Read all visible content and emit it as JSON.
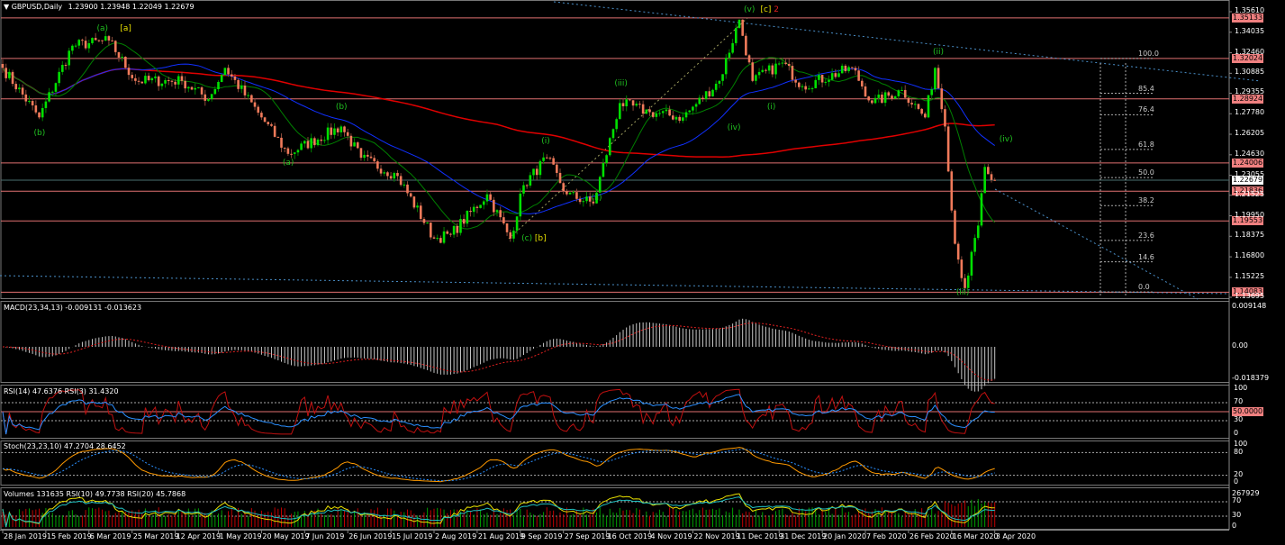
{
  "header": {
    "symbol_label": "▼ GBPUSD,Daily",
    "ohlc": "1.23900 1.23948 1.22049 1.22679"
  },
  "indicators": {
    "macd": "MACD(23,34,13) -0.009131 -0.013623",
    "rsi": "RSI(14) 47.6376  RSI(3) 31.4320",
    "stoch": "Stoch(23,23,10) 47.2704 28.6452",
    "volumes": "Volumes 131635  RSI(10) 49.7738  RSI(20) 45.7868"
  },
  "colors": {
    "bull": "#00e000",
    "bear": "#f07a5a",
    "level": "#e07070",
    "ma_long": "#e00000",
    "ma_mid": "#1030ff",
    "ma_fast": "#008000",
    "trend": "#4a8fc8"
  },
  "chart_data": {
    "type": "candlestick",
    "title": "GBPUSD,Daily",
    "ylim": [
      1.13695,
      1.3561
    ],
    "y_ticks": [
      "1.35610",
      "1.34035",
      "1.32460",
      "1.30885",
      "1.29355",
      "1.27780",
      "1.26205",
      "1.24630",
      "1.23055",
      "1.21525",
      "1.19950",
      "1.18375",
      "1.16800",
      "1.15225",
      "1.13695"
    ],
    "y_tick_values": [
      1.3561,
      1.34035,
      1.3246,
      1.30885,
      1.29355,
      1.2778,
      1.26205,
      1.2463,
      1.23055,
      1.21525,
      1.1995,
      1.18375,
      1.168,
      1.15225,
      1.13695
    ],
    "x_ticks": [
      "28 Jan 2019",
      "15 Feb 2019",
      "6 Mar 2019",
      "25 Mar 2019",
      "12 Apr 2019",
      "1 May 2019",
      "20 May 2019",
      "7 Jun 2019",
      "26 Jun 2019",
      "15 Jul 2019",
      "2 Aug 2019",
      "21 Aug 2019",
      "9 Sep 2019",
      "27 Sep 2019",
      "16 Oct 2019",
      "4 Nov 2019",
      "22 Nov 2019",
      "11 Dec 2019",
      "31 Dec 2019",
      "20 Jan 2020",
      "7 Feb 2020",
      "26 Feb 2020",
      "16 Mar 2020",
      "3 Apr 2020"
    ],
    "bars_per_tick": 13,
    "close_path": [
      [
        0,
        1.313
      ],
      [
        11,
        1.275
      ],
      [
        21,
        1.33
      ],
      [
        32,
        1.334
      ],
      [
        40,
        1.303
      ],
      [
        54,
        1.303
      ],
      [
        62,
        1.289
      ],
      [
        67,
        1.313
      ],
      [
        78,
        1.275
      ],
      [
        86,
        1.247
      ],
      [
        102,
        1.268
      ],
      [
        108,
        1.244
      ],
      [
        119,
        1.23
      ],
      [
        130,
        1.182
      ],
      [
        135,
        1.185
      ],
      [
        146,
        1.216
      ],
      [
        153,
        1.182
      ],
      [
        157,
        1.223
      ],
      [
        164,
        1.244
      ],
      [
        170,
        1.216
      ],
      [
        178,
        1.209
      ],
      [
        186,
        1.286
      ],
      [
        195,
        1.279
      ],
      [
        205,
        1.275
      ],
      [
        216,
        1.303
      ],
      [
        222,
        1.35
      ],
      [
        226,
        1.303
      ],
      [
        235,
        1.317
      ],
      [
        241,
        1.299
      ],
      [
        256,
        1.313
      ],
      [
        262,
        1.286
      ],
      [
        271,
        1.296
      ],
      [
        278,
        1.275
      ],
      [
        281,
        1.313
      ],
      [
        284,
        1.268
      ],
      [
        287,
        1.178
      ],
      [
        290,
        1.144
      ],
      [
        294,
        1.192
      ],
      [
        296,
        1.237
      ],
      [
        298,
        1.227
      ],
      [
        299,
        1.2268
      ]
    ],
    "horizontal_levels": [
      {
        "label": "1.35133",
        "value": 1.35133
      },
      {
        "label": "1.32024",
        "value": 1.32024
      },
      {
        "label": "1.28924",
        "value": 1.28924
      },
      {
        "label": "1.24006",
        "value": 1.24006
      },
      {
        "label": "1.21836",
        "value": 1.21836
      },
      {
        "label": "1.19553",
        "value": 1.19553
      },
      {
        "label": "1.14083",
        "value": 1.14083
      }
    ],
    "current_price": {
      "label": "1.22679",
      "value": 1.22679
    },
    "fib_levels": [
      {
        "label": "100.0",
        "value": 1.32024
      },
      {
        "label": "85.4",
        "value": 1.2935
      },
      {
        "label": "76.4",
        "value": 1.277
      },
      {
        "label": "61.8",
        "value": 1.2504
      },
      {
        "label": "50.0",
        "value": 1.2288
      },
      {
        "label": "38.2",
        "value": 1.2073
      },
      {
        "label": "23.6",
        "value": 1.1806
      },
      {
        "label": "14.6",
        "value": 1.1642
      },
      {
        "label": "0.0",
        "value": 1.141
      }
    ],
    "wave_labels": [
      {
        "text": "(b)",
        "bar": 11,
        "price": 1.262,
        "color": "#20c020"
      },
      {
        "text": "(a)",
        "bar": 30,
        "price": 1.342,
        "color": "#20c020"
      },
      {
        "text": "[a]",
        "bar": 37,
        "price": 1.342,
        "color": "#e8e000"
      },
      {
        "text": "(a)",
        "bar": 86,
        "price": 1.239,
        "color": "#20c020"
      },
      {
        "text": "(b)",
        "bar": 102,
        "price": 1.282,
        "color": "#20c020"
      },
      {
        "text": "(c)",
        "bar": 158,
        "price": 1.181,
        "color": "#20c020"
      },
      {
        "text": "[b]",
        "bar": 162,
        "price": 1.181,
        "color": "#e8e000"
      },
      {
        "text": "(i)",
        "bar": 164,
        "price": 1.256,
        "color": "#20c020"
      },
      {
        "text": "(ii)",
        "bar": 179,
        "price": 1.212,
        "color": "#20c020"
      },
      {
        "text": "(iii)",
        "bar": 186,
        "price": 1.3,
        "color": "#20c020"
      },
      {
        "text": "(iv)",
        "bar": 220,
        "price": 1.266,
        "color": "#20c020"
      },
      {
        "text": "(v)",
        "bar": 225,
        "price": 1.357,
        "color": "#20c020"
      },
      {
        "text": "[c]",
        "bar": 230,
        "price": 1.357,
        "color": "#e8e000"
      },
      {
        "text": "2",
        "bar": 234,
        "price": 1.357,
        "color": "#e02020"
      },
      {
        "text": "(i)",
        "bar": 232,
        "price": 1.282,
        "color": "#20c020"
      },
      {
        "text": "(ii)",
        "bar": 282,
        "price": 1.324,
        "color": "#20c020"
      },
      {
        "text": "(iii)",
        "bar": 289,
        "price": 1.14,
        "color": "#20c020"
      },
      {
        "text": "(iv)",
        "bar": 302,
        "price": 1.257,
        "color": "#20c020"
      }
    ],
    "macd_axis": [
      "0.009148",
      "0.00",
      "-0.018379"
    ],
    "rsi_axis": [
      "100",
      "70",
      "50.0000",
      "30",
      "0"
    ],
    "stoch_axis": [
      "100",
      "80",
      "20",
      "0"
    ],
    "volume_axis": [
      "267929",
      "70",
      "30",
      "0"
    ]
  }
}
